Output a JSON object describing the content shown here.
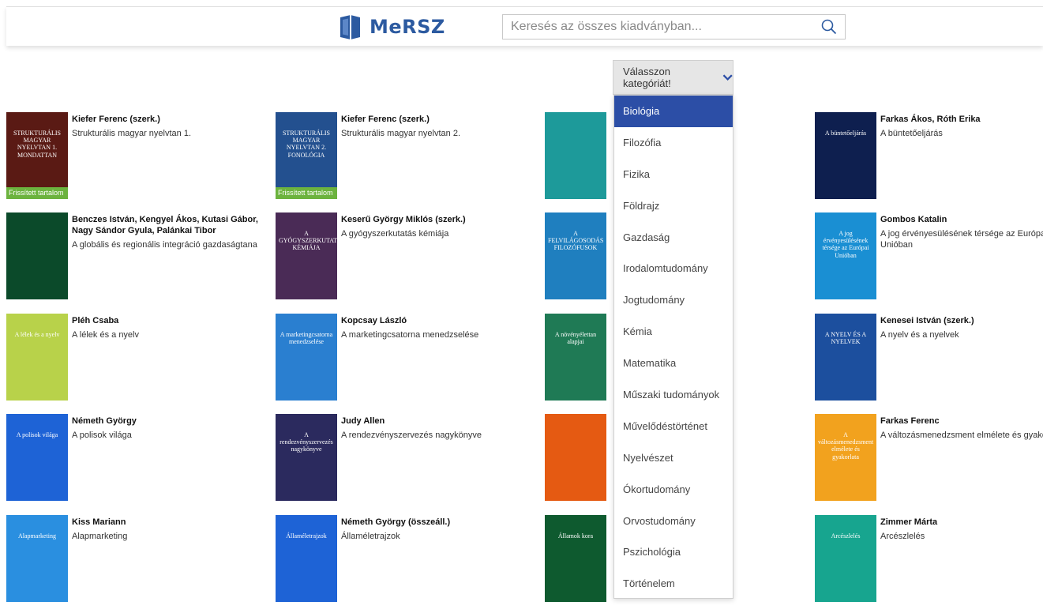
{
  "header": {
    "logo_text": "MeRSZ",
    "search_placeholder": "Keresés az összes kiadványban..."
  },
  "category": {
    "label": "Válasszon kategóriát!",
    "options": [
      "Biológia",
      "Filozófia",
      "Fizika",
      "Földrajz",
      "Gazdaság",
      "Irodalomtudomány",
      "Jogtudomány",
      "Kémia",
      "Matematika",
      "Műszaki tudományok",
      "Művelődéstörténet",
      "Nyelvészet",
      "Ókortudomány",
      "Orvostudomány",
      "Pszichológia",
      "Történelem"
    ],
    "selected": "Biológia"
  },
  "badge_label": "Frissített tartalom",
  "books": [
    {
      "author": "Kiefer Ferenc (szerk.)",
      "title": "Strukturális magyar nyelvtan 1.",
      "cover_text": "STRUKTURÁLIS MAGYAR NYELVTAN 1. MONDATTAN",
      "badge": true,
      "color": "#5a1a14"
    },
    {
      "author": "Kiefer Ferenc (szerk.)",
      "title": "Strukturális magyar nyelvtan 2.",
      "cover_text": "STRUKTURÁLIS MAGYAR NYELVTAN 2. FONOLÓGIA",
      "badge": true,
      "color": "#23508f"
    },
    {
      "author": "",
      "title": "",
      "cover_text": "",
      "badge": false,
      "color": "#1d9a9a"
    },
    {
      "author": "Farkas Ákos, Róth Erika",
      "title": "A büntetőeljárás",
      "cover_text": "A büntetőeljárás",
      "badge": false,
      "color": "#0e1f4f"
    },
    {
      "author": "Benczes István, Kengyel Ákos, Kutasi Gábor, Nagy Sándor Gyula, Palánkai Tibor",
      "title": "A globális és regionális integráció gazdaságtana",
      "cover_text": "",
      "badge": false,
      "color": "#0b4a2a"
    },
    {
      "author": "Keserű György Miklós (szerk.)",
      "title": "A gyógyszerkutatás kémiája",
      "cover_text": "A GYÓGYSZERKUTATÁS KÉMIÁJA",
      "badge": false,
      "color": "#4a2b56"
    },
    {
      "author": "",
      "title": "",
      "cover_text": "A FELVILÁGOSODÁS FILOZÓFUSOK",
      "badge": false,
      "color": "#1f7fbf"
    },
    {
      "author": "Gombos Katalin",
      "title": "A jog érvényesülésének térsége az Európai Unióban",
      "cover_text": "A jog érvényesülésének térsége az Európai Unióban",
      "badge": false,
      "color": "#1a8fd3"
    },
    {
      "author": "Pléh Csaba",
      "title": "A lélek és a nyelv",
      "cover_text": "A lélek és a nyelv",
      "badge": false,
      "color": "#b8d24a"
    },
    {
      "author": "Kopcsay László",
      "title": "A marketingcsatorna menedzselése",
      "cover_text": "A marketingcsatorna menedzselése",
      "badge": false,
      "color": "#2a7fd0"
    },
    {
      "author": "",
      "title": "",
      "cover_text": "A növényélettan alapjai",
      "badge": false,
      "color": "#1f7a55"
    },
    {
      "author": "Kenesei István (szerk.)",
      "title": "A nyelv és a nyelvek",
      "cover_text": "A NYELV ÉS A NYELVEK",
      "badge": false,
      "color": "#1c4f9e"
    },
    {
      "author": "Németh György",
      "title": "A polisok világa",
      "cover_text": "A polisok világa",
      "badge": false,
      "color": "#1e63d6"
    },
    {
      "author": "Judy Allen",
      "title": "A rendezvényszervezés nagykönyve",
      "cover_text": "A rendezvényszervezés nagykönyve",
      "badge": false,
      "color": "#2b2a5e"
    },
    {
      "author": "",
      "title": "",
      "cover_text": "",
      "badge": false,
      "color": "#e55a12"
    },
    {
      "author": "Farkas Ferenc",
      "title": "A változásmenedzsment elmélete és gyakorlata",
      "cover_text": "A változásmenedzsment elmélete és gyakorlata",
      "badge": false,
      "color": "#f2a21e"
    },
    {
      "author": "Kiss Mariann",
      "title": "Alapmarketing",
      "cover_text": "Alapmarketing",
      "badge": false,
      "color": "#2a8fe0"
    },
    {
      "author": "Németh György (összeáll.)",
      "title": "Államéletrajzok",
      "cover_text": "Államéletrajzok",
      "badge": false,
      "color": "#1e63d6"
    },
    {
      "author": "",
      "title": "",
      "cover_text": "Államok kora",
      "badge": false,
      "color": "#0e5a2f"
    },
    {
      "author": "Zimmer Márta",
      "title": "Arcészlelés",
      "cover_text": "Arcészlelés",
      "badge": false,
      "color": "#17a58f"
    }
  ]
}
